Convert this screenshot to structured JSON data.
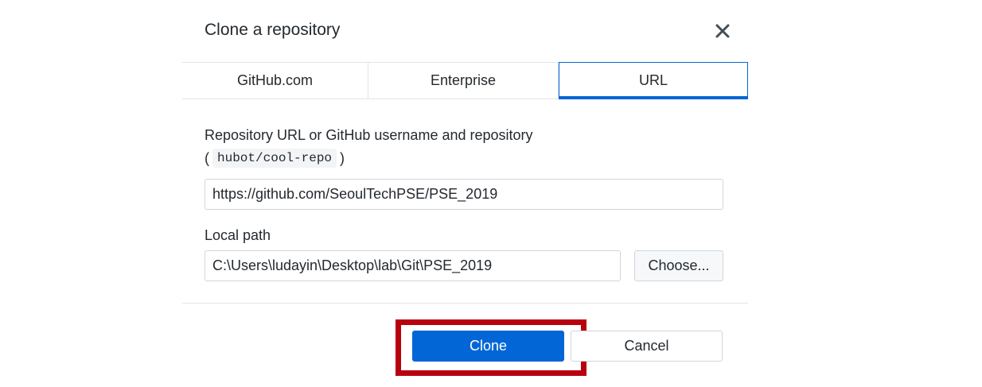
{
  "dialog": {
    "title": "Clone a repository",
    "close_icon": "close-icon"
  },
  "tabs": [
    {
      "label": "GitHub.com",
      "selected": false
    },
    {
      "label": "Enterprise",
      "selected": false
    },
    {
      "label": "URL",
      "selected": true
    }
  ],
  "form": {
    "url_label": "Repository URL or GitHub username and repository",
    "hint_open": "(",
    "hint_example": "hubot/cool-repo",
    "hint_close": ")",
    "url_value": "https://github.com/SeoulTechPSE/PSE_2019",
    "path_label": "Local path",
    "path_value": "C:\\Users\\ludayin\\Desktop\\lab\\Git\\PSE_2019",
    "choose_label": "Choose..."
  },
  "footer": {
    "clone_label": "Clone",
    "cancel_label": "Cancel"
  },
  "colors": {
    "accent": "#0366d6",
    "highlight": "#b8000f",
    "border": "#e1e4e8"
  }
}
